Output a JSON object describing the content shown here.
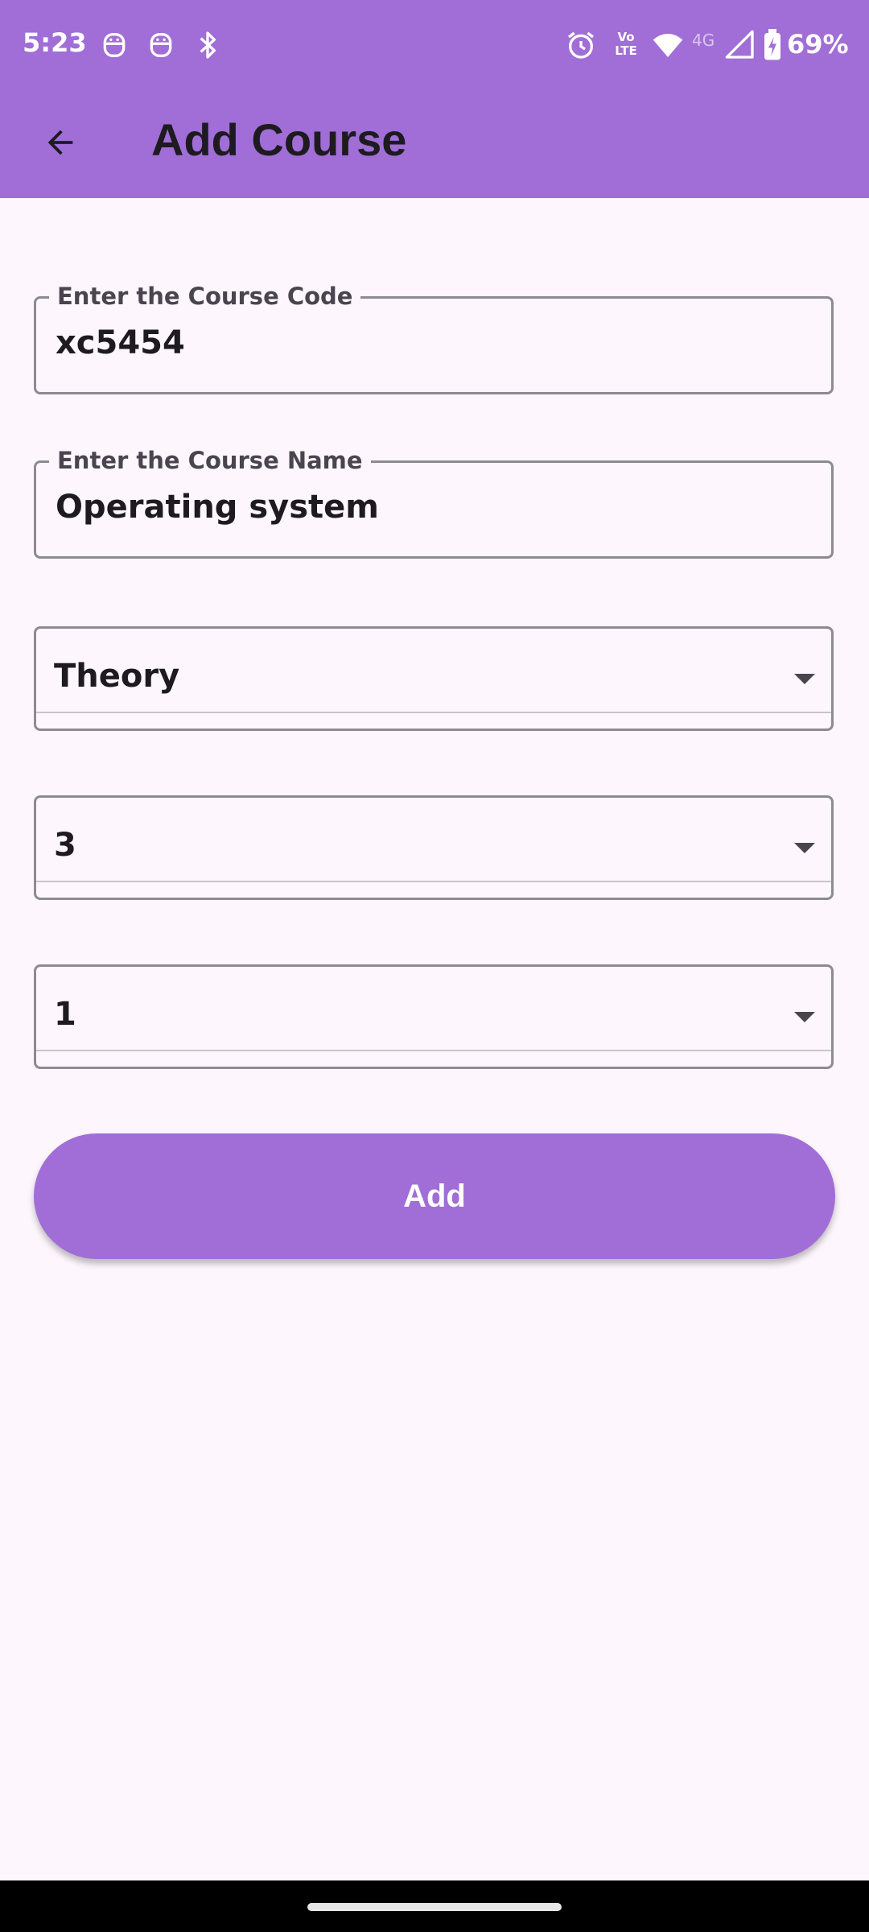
{
  "status_bar": {
    "time": "5:23",
    "left_icons": [
      "robot-icon",
      "robot-icon",
      "bluetooth-icon"
    ],
    "right_icons": [
      "alarm-icon",
      "volte-icon",
      "wifi-icon",
      "signal-icon",
      "battery-charging-icon"
    ],
    "volte_text": "Vo LTE",
    "network_type": "4G",
    "battery": "69%"
  },
  "app_bar": {
    "back_icon": "arrow-back-icon",
    "title": "Add Course",
    "background": "#a06ed6"
  },
  "form": {
    "course_code": {
      "label": "Enter the Course Code",
      "value": "xc5454"
    },
    "course_name": {
      "label": "Enter the Course Name",
      "value": "Operating system"
    },
    "course_type": {
      "selected": "Theory"
    },
    "credits": {
      "selected": "3"
    },
    "third_select": {
      "selected": "1"
    },
    "add_button": {
      "label": "Add"
    }
  },
  "colors": {
    "primary": "#a06ed6",
    "background": "#fdf6fd",
    "outline": "#8e8a93",
    "text": "#1d1b20"
  }
}
